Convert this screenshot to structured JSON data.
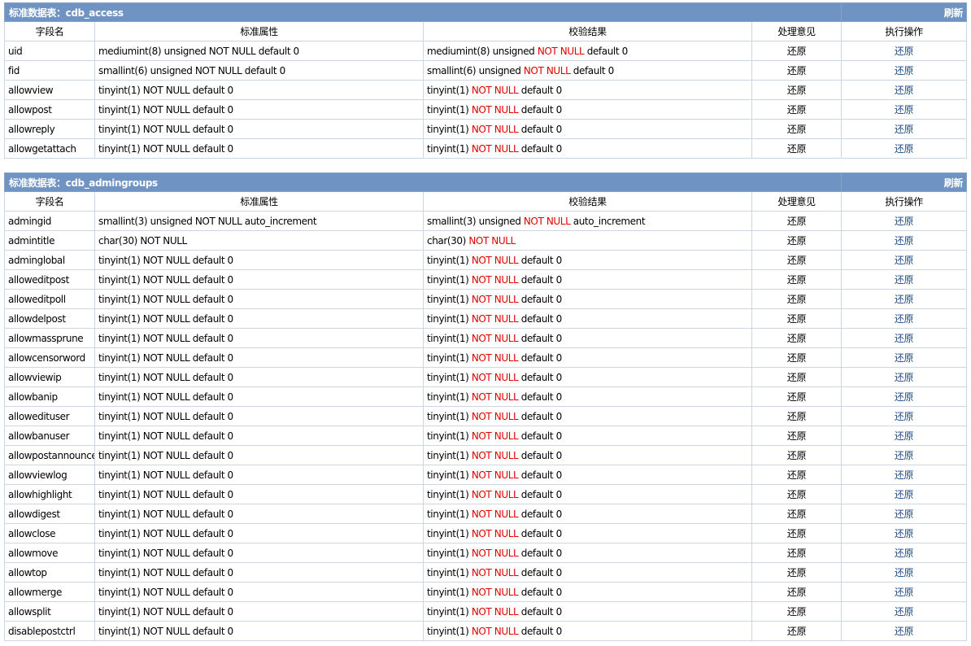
{
  "column_headers": [
    "字段名",
    "标准属性",
    "校验结果",
    "处理意见",
    "执行操作"
  ],
  "refresh_label": "刷新",
  "tables": [
    {
      "title": "标准数据表：cdb_access",
      "rows": [
        {
          "field": "uid",
          "std": "mediumint(8) unsigned NOT NULL default 0",
          "check_pre": "mediumint(8) unsigned ",
          "check_red": "NOT NULL",
          "check_post": " default 0",
          "opinion": "还原",
          "action": "还原"
        },
        {
          "field": "fid",
          "std": "smallint(6) unsigned NOT NULL default 0",
          "check_pre": "smallint(6) unsigned ",
          "check_red": "NOT NULL",
          "check_post": " default 0",
          "opinion": "还原",
          "action": "还原"
        },
        {
          "field": "allowview",
          "std": "tinyint(1) NOT NULL default 0",
          "check_pre": "tinyint(1) ",
          "check_red": "NOT NULL",
          "check_post": " default 0",
          "opinion": "还原",
          "action": "还原"
        },
        {
          "field": "allowpost",
          "std": "tinyint(1) NOT NULL default 0",
          "check_pre": "tinyint(1) ",
          "check_red": "NOT NULL",
          "check_post": " default 0",
          "opinion": "还原",
          "action": "还原"
        },
        {
          "field": "allowreply",
          "std": "tinyint(1) NOT NULL default 0",
          "check_pre": "tinyint(1) ",
          "check_red": "NOT NULL",
          "check_post": " default 0",
          "opinion": "还原",
          "action": "还原"
        },
        {
          "field": "allowgetattach",
          "std": "tinyint(1) NOT NULL default 0",
          "check_pre": "tinyint(1) ",
          "check_red": "NOT NULL",
          "check_post": " default 0",
          "opinion": "还原",
          "action": "还原"
        }
      ]
    },
    {
      "title": "标准数据表：cdb_admingroups",
      "rows": [
        {
          "field": "admingid",
          "std": "smallint(3) unsigned NOT NULL auto_increment",
          "check_pre": "smallint(3) unsigned ",
          "check_red": "NOT NULL",
          "check_post": " auto_increment",
          "opinion": "还原",
          "action": "还原"
        },
        {
          "field": "admintitle",
          "std": "char(30) NOT NULL",
          "check_pre": "char(30) ",
          "check_red": "NOT NULL",
          "check_post": "",
          "opinion": "还原",
          "action": "还原"
        },
        {
          "field": "adminglobal",
          "std": "tinyint(1) NOT NULL default 0",
          "check_pre": "tinyint(1) ",
          "check_red": "NOT NULL",
          "check_post": " default 0",
          "opinion": "还原",
          "action": "还原"
        },
        {
          "field": "alloweditpost",
          "std": "tinyint(1) NOT NULL default 0",
          "check_pre": "tinyint(1) ",
          "check_red": "NOT NULL",
          "check_post": " default 0",
          "opinion": "还原",
          "action": "还原"
        },
        {
          "field": "alloweditpoll",
          "std": "tinyint(1) NOT NULL default 0",
          "check_pre": "tinyint(1) ",
          "check_red": "NOT NULL",
          "check_post": " default 0",
          "opinion": "还原",
          "action": "还原"
        },
        {
          "field": "allowdelpost",
          "std": "tinyint(1) NOT NULL default 0",
          "check_pre": "tinyint(1) ",
          "check_red": "NOT NULL",
          "check_post": " default 0",
          "opinion": "还原",
          "action": "还原"
        },
        {
          "field": "allowmassprune",
          "std": "tinyint(1) NOT NULL default 0",
          "check_pre": "tinyint(1) ",
          "check_red": "NOT NULL",
          "check_post": " default 0",
          "opinion": "还原",
          "action": "还原"
        },
        {
          "field": "allowcensorword",
          "std": "tinyint(1) NOT NULL default 0",
          "check_pre": "tinyint(1) ",
          "check_red": "NOT NULL",
          "check_post": " default 0",
          "opinion": "还原",
          "action": "还原"
        },
        {
          "field": "allowviewip",
          "std": "tinyint(1) NOT NULL default 0",
          "check_pre": "tinyint(1) ",
          "check_red": "NOT NULL",
          "check_post": " default 0",
          "opinion": "还原",
          "action": "还原"
        },
        {
          "field": "allowbanip",
          "std": "tinyint(1) NOT NULL default 0",
          "check_pre": "tinyint(1) ",
          "check_red": "NOT NULL",
          "check_post": " default 0",
          "opinion": "还原",
          "action": "还原"
        },
        {
          "field": "allowedituser",
          "std": "tinyint(1) NOT NULL default 0",
          "check_pre": "tinyint(1) ",
          "check_red": "NOT NULL",
          "check_post": " default 0",
          "opinion": "还原",
          "action": "还原"
        },
        {
          "field": "allowbanuser",
          "std": "tinyint(1) NOT NULL default 0",
          "check_pre": "tinyint(1) ",
          "check_red": "NOT NULL",
          "check_post": " default 0",
          "opinion": "还原",
          "action": "还原"
        },
        {
          "field": "allowpostannounce",
          "std": "tinyint(1) NOT NULL default 0",
          "check_pre": "tinyint(1) ",
          "check_red": "NOT NULL",
          "check_post": " default 0",
          "opinion": "还原",
          "action": "还原"
        },
        {
          "field": "allowviewlog",
          "std": "tinyint(1) NOT NULL default 0",
          "check_pre": "tinyint(1) ",
          "check_red": "NOT NULL",
          "check_post": " default 0",
          "opinion": "还原",
          "action": "还原"
        },
        {
          "field": "allowhighlight",
          "std": "tinyint(1) NOT NULL default 0",
          "check_pre": "tinyint(1) ",
          "check_red": "NOT NULL",
          "check_post": " default 0",
          "opinion": "还原",
          "action": "还原"
        },
        {
          "field": "allowdigest",
          "std": "tinyint(1) NOT NULL default 0",
          "check_pre": "tinyint(1) ",
          "check_red": "NOT NULL",
          "check_post": " default 0",
          "opinion": "还原",
          "action": "还原"
        },
        {
          "field": "allowclose",
          "std": "tinyint(1) NOT NULL default 0",
          "check_pre": "tinyint(1) ",
          "check_red": "NOT NULL",
          "check_post": " default 0",
          "opinion": "还原",
          "action": "还原"
        },
        {
          "field": "allowmove",
          "std": "tinyint(1) NOT NULL default 0",
          "check_pre": "tinyint(1) ",
          "check_red": "NOT NULL",
          "check_post": " default 0",
          "opinion": "还原",
          "action": "还原"
        },
        {
          "field": "allowtop",
          "std": "tinyint(1) NOT NULL default 0",
          "check_pre": "tinyint(1) ",
          "check_red": "NOT NULL",
          "check_post": " default 0",
          "opinion": "还原",
          "action": "还原"
        },
        {
          "field": "allowmerge",
          "std": "tinyint(1) NOT NULL default 0",
          "check_pre": "tinyint(1) ",
          "check_red": "NOT NULL",
          "check_post": " default 0",
          "opinion": "还原",
          "action": "还原"
        },
        {
          "field": "allowsplit",
          "std": "tinyint(1) NOT NULL default 0",
          "check_pre": "tinyint(1) ",
          "check_red": "NOT NULL",
          "check_post": " default 0",
          "opinion": "还原",
          "action": "还原"
        },
        {
          "field": "disablepostctrl",
          "std": "tinyint(1) NOT NULL default 0",
          "check_pre": "tinyint(1) ",
          "check_red": "NOT NULL",
          "check_post": " default 0",
          "opinion": "还原",
          "action": "还原"
        }
      ]
    }
  ]
}
